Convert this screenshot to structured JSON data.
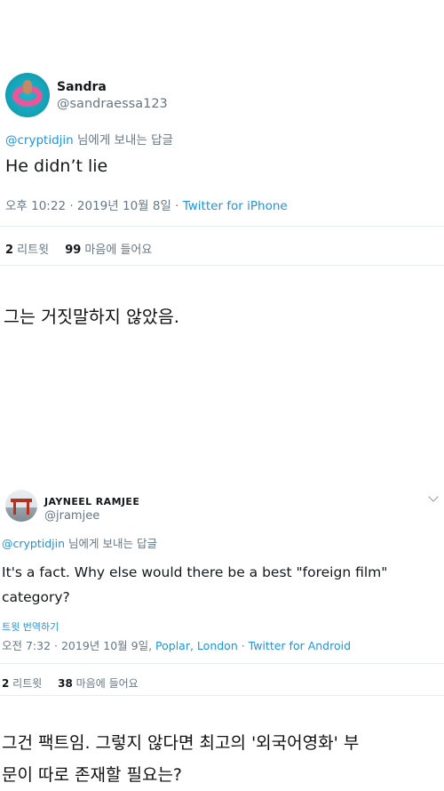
{
  "tweet1": {
    "name": "Sandra",
    "handle": "@sandraessa123",
    "reply_to_handle": "@cryptidjin",
    "reply_to_suffix": " 님에게 보내는 답글",
    "text": "He didn’t lie",
    "timestamp": "오후 10:22 · 2019년 10월 8일 · ",
    "source": "Twitter for iPhone",
    "retweets_count": "2",
    "retweets_label": " 리트윗",
    "likes_count": "99",
    "likes_label": " 마음에 들어요"
  },
  "translation1": "그는 거짓말하지 않았음.",
  "tweet2": {
    "name": "JAYNEEL RAMJEE",
    "handle": "@jramjee",
    "reply_to_handle": "@cryptidjin",
    "reply_to_suffix": " 님에게 보내는 답글",
    "text_line1": "It's a fact. Why else would there be a best \"foreign film\"",
    "text_line2": "category?",
    "translate_link": "트윗 번역하기",
    "timestamp": "오전 7:32 · 2019년 10월 9일, ",
    "location": "Poplar, London",
    "sep": " · ",
    "source": "Twitter for Android",
    "retweets_count": "2",
    "retweets_label": " 리트윗",
    "likes_count": "38",
    "likes_label": " 마음에 들어요"
  },
  "translation2": {
    "line1": "그건 팩트임. 그렇지 않다면 최고의 '외국어영화' 부",
    "line2": "문이 따로 존재할 필요는?"
  },
  "icons": {
    "more": "chevron-down-icon"
  }
}
